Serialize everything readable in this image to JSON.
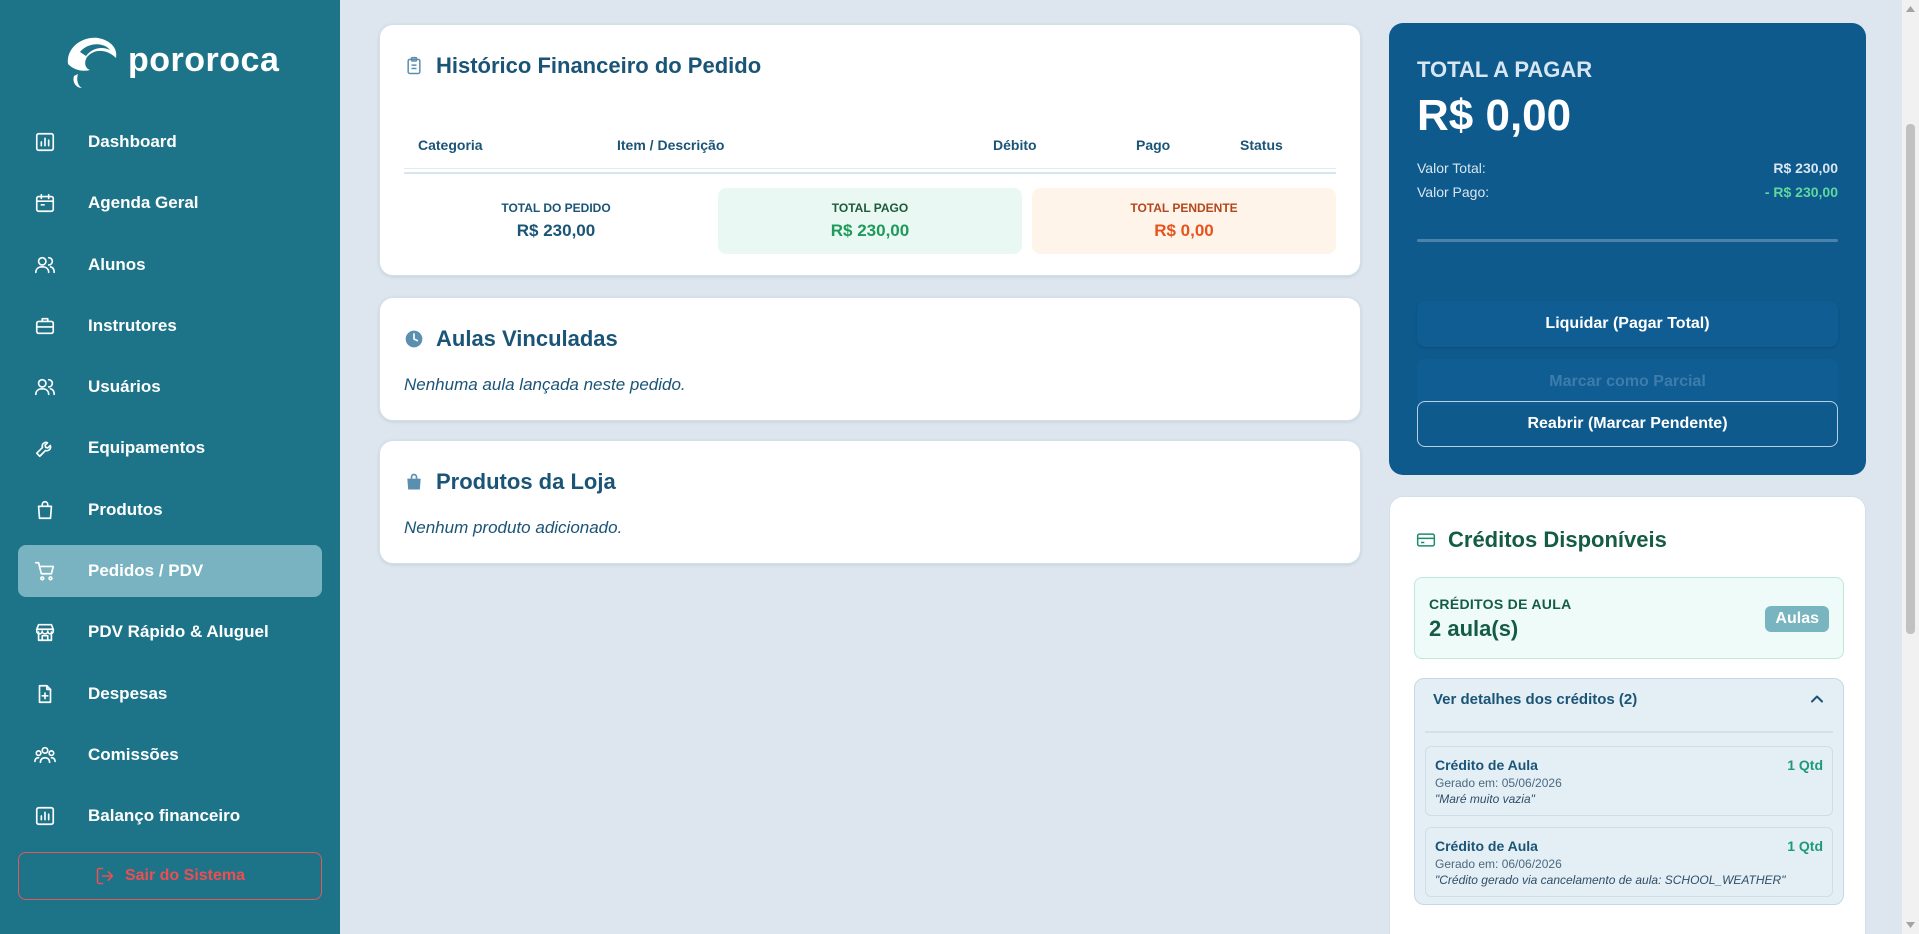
{
  "brand": {
    "name": "pororoca"
  },
  "sidebar": {
    "items": [
      {
        "label": "Dashboard",
        "icon": "chart-bars-icon"
      },
      {
        "label": "Agenda Geral",
        "icon": "calendar-icon"
      },
      {
        "label": "Alunos",
        "icon": "users-icon"
      },
      {
        "label": "Instrutores",
        "icon": "briefcase-icon"
      },
      {
        "label": "Usuários",
        "icon": "users-icon"
      },
      {
        "label": "Equipamentos",
        "icon": "wrench-icon"
      },
      {
        "label": "Produtos",
        "icon": "bag-icon"
      },
      {
        "label": "Pedidos / PDV",
        "icon": "cart-icon",
        "active": true
      },
      {
        "label": "PDV Rápido & Aluguel",
        "icon": "store-icon"
      },
      {
        "label": "Despesas",
        "icon": "file-plus-icon"
      },
      {
        "label": "Comissões",
        "icon": "group-icon"
      },
      {
        "label": "Balanço financeiro",
        "icon": "chart-bars-icon"
      }
    ],
    "logout_label": "Sair do Sistema"
  },
  "historico": {
    "title": "Histórico Financeiro do Pedido",
    "columns": [
      "Categoria",
      "Item / Descrição",
      "Débito",
      "Pago",
      "Status"
    ],
    "totals": [
      {
        "label": "TOTAL DO PEDIDO",
        "value": "R$ 230,00"
      },
      {
        "label": "TOTAL PAGO",
        "value": "R$ 230,00"
      },
      {
        "label": "TOTAL PENDENTE",
        "value": "R$ 0,00"
      }
    ]
  },
  "aulas": {
    "title": "Aulas Vinculadas",
    "empty": "Nenhuma aula lançada neste pedido."
  },
  "produtos": {
    "title": "Produtos da Loja",
    "empty": "Nenhum produto adicionado."
  },
  "pagamento": {
    "title": "TOTAL A PAGAR",
    "amount": "R$ 0,00",
    "valor_total_label": "Valor Total:",
    "valor_total": "R$ 230,00",
    "valor_pago_label": "Valor Pago:",
    "valor_pago": "- R$ 230,00",
    "btn_liquidar": "Liquidar (Pagar Total)",
    "btn_parcial": "Marcar como Parcial",
    "btn_reabrir": "Reabrir (Marcar Pendente)"
  },
  "creditos": {
    "title": "Créditos Disponíveis",
    "label": "CRÉDITOS DE AULA",
    "value": "2 aula(s)",
    "badge": "Aulas",
    "details_label": "Ver detalhes dos créditos (2)",
    "items": [
      {
        "name": "Crédito de Aula",
        "qty": "1 Qtd",
        "date": "Gerado em: 05/06/2026",
        "note": "\"Maré muito vazia\""
      },
      {
        "name": "Crédito de Aula",
        "qty": "1 Qtd",
        "date": "Gerado em: 06/06/2026",
        "note": "\"Crédito gerado via cancelamento de aula: SCHOOL_WEATHER\""
      }
    ]
  },
  "colors": {
    "sidebar": "#1d7489",
    "active_item": "#79b3c1",
    "pay_panel": "#0e5a8d",
    "danger": "#ef4d50"
  }
}
